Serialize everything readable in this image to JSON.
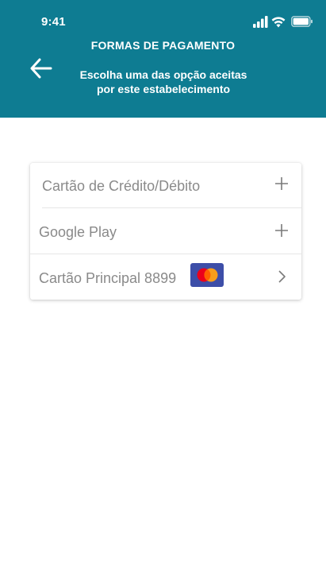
{
  "status_bar": {
    "time": "9:41",
    "icons": [
      "signal-icon",
      "wifi-icon",
      "battery-icon"
    ]
  },
  "header": {
    "title": "FORMAS DE PAGAMENTO",
    "subtitle_line1": "Escolha uma das opção aceitas",
    "subtitle_line2": "por este estabelecimento",
    "back_icon": "arrow-left-icon"
  },
  "payment_options": [
    {
      "label": "Cartão de Crédito/Débito",
      "action_icon": "plus-icon"
    },
    {
      "label": "Google Play",
      "action_icon": "plus-icon"
    },
    {
      "label": "Cartão Principal 8899",
      "brand_icon": "mastercard-icon",
      "action_icon": "chevron-right-icon"
    }
  ],
  "colors": {
    "header_background": "#0e7c92",
    "header_text": "#ffffff",
    "item_text": "#8a8a8a",
    "brand_badge": "#3d4ea8",
    "mastercard_red": "#eb001b",
    "mastercard_yellow": "#f79e1b"
  }
}
